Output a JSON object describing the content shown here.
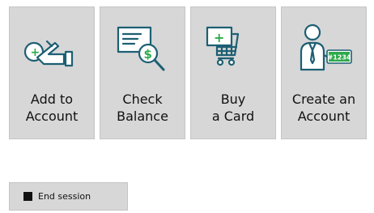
{
  "tiles": [
    {
      "label": "Add to\nAccount",
      "icon": "add-money-hand-icon"
    },
    {
      "label": "Check\nBalance",
      "icon": "check-balance-icon"
    },
    {
      "label": "Buy\na Card",
      "icon": "buy-card-cart-icon"
    },
    {
      "label": "Create an\nAccount",
      "icon": "create-account-person-icon",
      "badge": "#1234"
    }
  ],
  "end_session": {
    "label": "End session"
  },
  "colors": {
    "tile_bg": "#d7d7d7",
    "icon_stroke": "#1d5f73",
    "accent_green": "#2eaa4a",
    "text": "#111111"
  }
}
